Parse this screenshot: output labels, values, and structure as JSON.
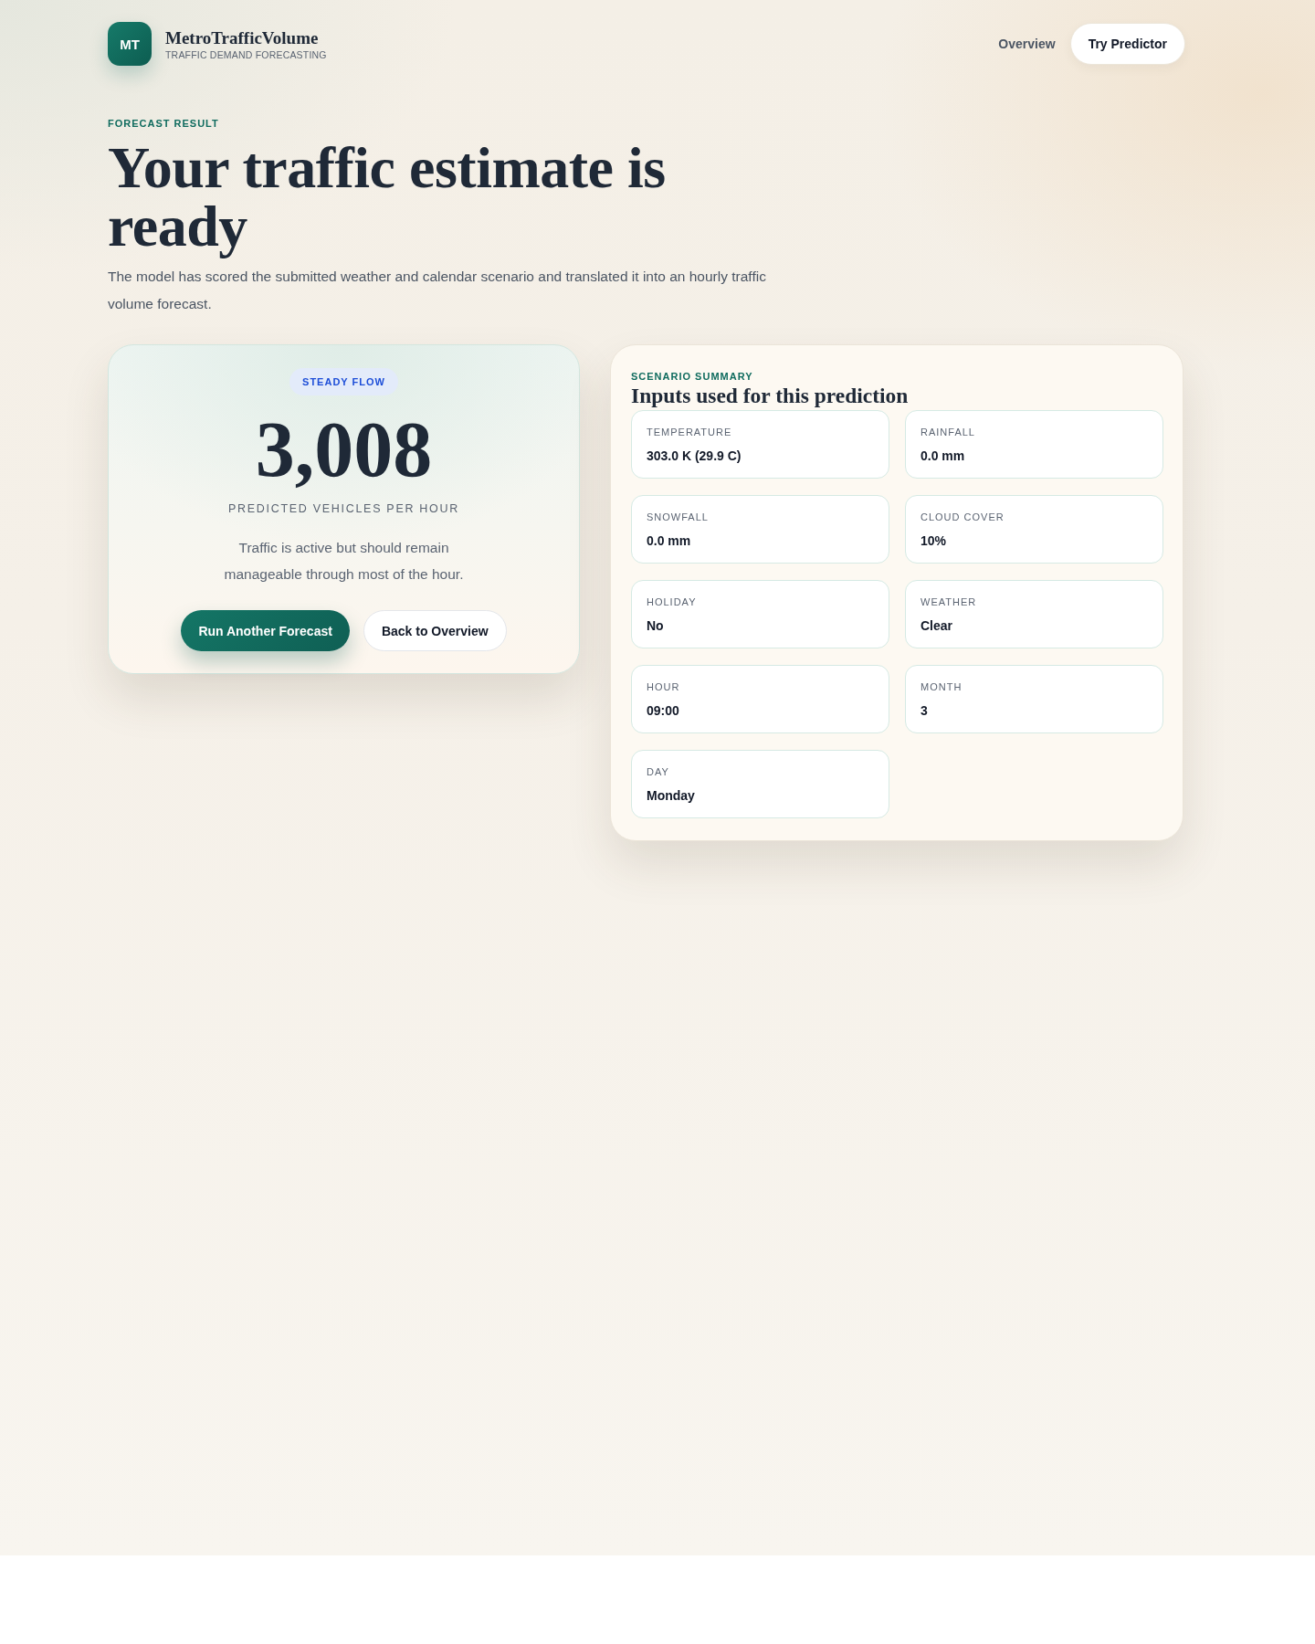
{
  "header": {
    "logo": {
      "initials": "MT"
    },
    "brand": {
      "name": "MetroTrafficVolume",
      "tagline": "TRAFFIC DEMAND FORECASTING"
    },
    "nav": [
      {
        "label": "Overview",
        "kind": "link"
      },
      {
        "label": "Try Predictor",
        "kind": "pill"
      }
    ]
  },
  "hero": {
    "eyebrow": "FORECAST RESULT",
    "title": "Your traffic estimate is ready",
    "description": "The model has scored the submitted weather and calendar scenario and translated it into an hourly traffic volume forecast."
  },
  "result_card": {
    "badge": "STEADY FLOW",
    "value": "3,008",
    "unit": "PREDICTED VEHICLES PER HOUR",
    "message": "Traffic is active but should remain manageable through most of the hour.",
    "buttons": [
      {
        "label": "Run Another Forecast",
        "kind": "primary"
      },
      {
        "label": "Back to Overview",
        "kind": "secondary"
      }
    ]
  },
  "summary_card": {
    "eyebrow": "SCENARIO SUMMARY",
    "title": "Inputs used for this prediction",
    "inputs": [
      {
        "label": "TEMPERATURE",
        "value": "303.0 K (29.9 C)"
      },
      {
        "label": "RAINFALL",
        "value": "0.0 mm"
      },
      {
        "label": "SNOWFALL",
        "value": "0.0 mm"
      },
      {
        "label": "CLOUD COVER",
        "value": "10%"
      },
      {
        "label": "HOLIDAY",
        "value": "No"
      },
      {
        "label": "WEATHER",
        "value": "Clear"
      },
      {
        "label": "HOUR",
        "value": "09:00"
      },
      {
        "label": "MONTH",
        "value": "3"
      },
      {
        "label": "DAY",
        "value": "Monday"
      }
    ]
  }
}
